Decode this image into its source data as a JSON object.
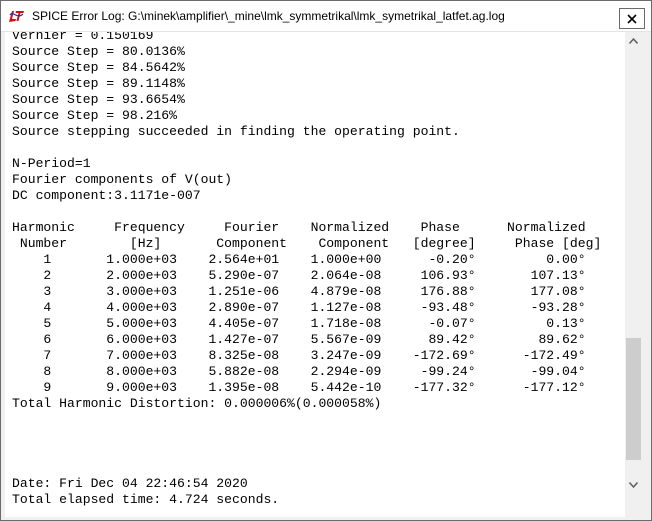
{
  "window": {
    "title": "SPICE Error Log: G:\\minek\\amplifier\\_mine\\lmk_symmetrikal\\lmk_symetrikal_latfet.ag.log",
    "app_icon": "ltspice-logo-icon",
    "close_icon": "close-icon"
  },
  "log": {
    "lines": [
      "Vernier = 0.150169",
      "Source Step = 80.0136%",
      "Source Step = 84.5642%",
      "Source Step = 89.1148%",
      "Source Step = 93.6654%",
      "Source Step = 98.216%",
      "Source stepping succeeded in finding the operating point.",
      "",
      "N-Period=1",
      "Fourier components of V(out)",
      "DC component:3.1171e-007",
      "",
      "Harmonic     Frequency     Fourier    Normalized    Phase      Normalized",
      " Number        [Hz]       Component    Component   [degree]     Phase [deg]",
      "    1       1.000e+03    2.564e+01    1.000e+00      -0.20°         0.00°",
      "    2       2.000e+03    5.290e-07    2.064e-08     106.93°       107.13°",
      "    3       3.000e+03    1.251e-06    4.879e-08     176.88°       177.08°",
      "    4       4.000e+03    2.890e-07    1.127e-08     -93.48°       -93.28°",
      "    5       5.000e+03    4.405e-07    1.718e-08      -0.07°         0.13°",
      "    6       6.000e+03    1.427e-07    5.567e-09      89.42°        89.62°",
      "    7       7.000e+03    8.325e-08    3.247e-09    -172.69°      -172.49°",
      "    8       8.000e+03    5.882e-08    2.294e-09     -99.24°       -99.04°",
      "    9       9.000e+03    1.395e-08    5.442e-10    -177.32°      -177.12°",
      "Total Harmonic Distortion: 0.000006%(0.000058%)",
      "",
      "",
      "",
      "",
      "Date: Fri Dec 04 22:46:54 2020",
      "Total elapsed time: 4.724 seconds."
    ]
  },
  "scrollbar": {
    "up_icon": "scroll-up-arrow-icon",
    "down_icon": "scroll-down-arrow-icon",
    "position_fraction": 0.88
  }
}
